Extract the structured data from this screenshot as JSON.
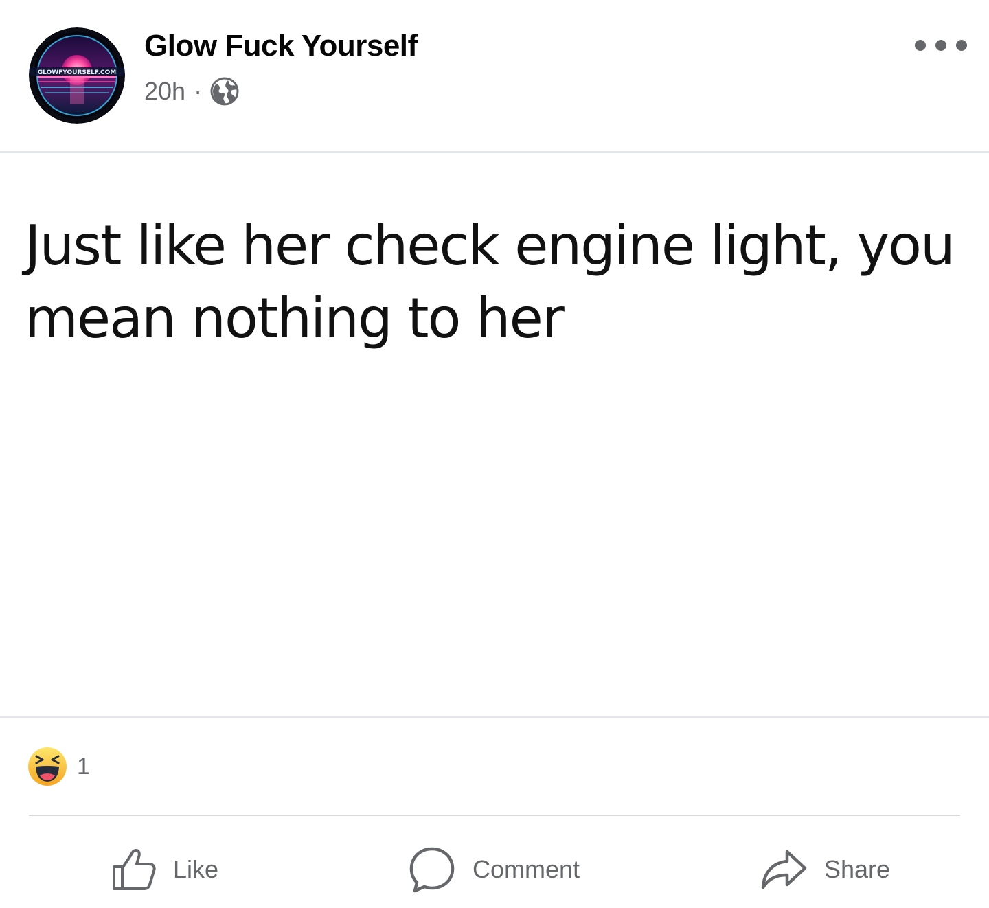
{
  "post": {
    "author": "Glow Fuck Yourself",
    "avatar_text": "GLOWFYOURSELF.COM",
    "timestamp": "20h",
    "separator": "·",
    "privacy_icon": "globe-icon",
    "more_icon": "more-options-icon",
    "text": "Just like her check engine light, you mean nothing to her"
  },
  "reactions": {
    "icon": "haha-reaction-icon",
    "count": "1"
  },
  "actions": {
    "like_label": "Like",
    "comment_label": "Comment",
    "share_label": "Share"
  },
  "colors": {
    "secondary_text": "#65676b",
    "divider": "#e4e6eb",
    "haha_yellow": "#f7b928"
  }
}
